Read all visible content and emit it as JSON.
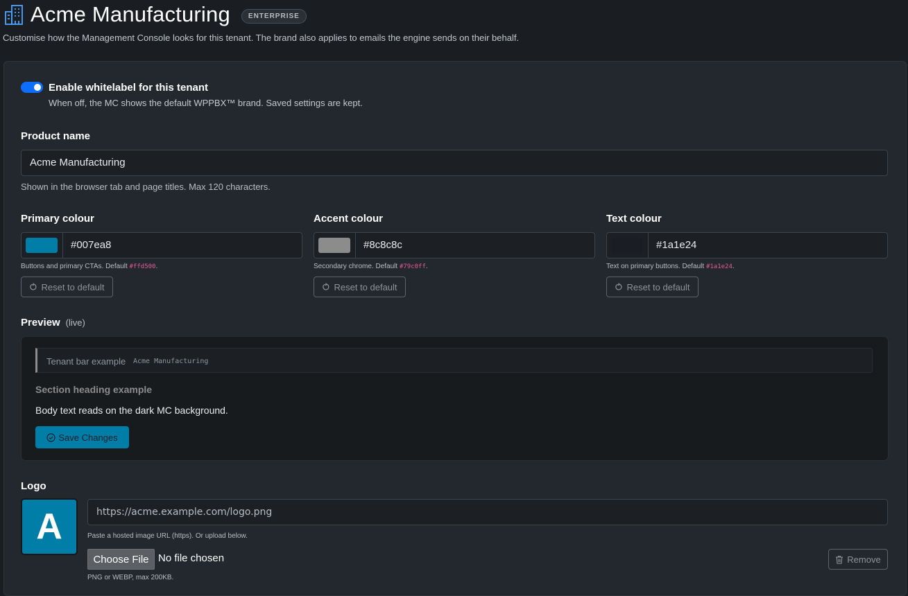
{
  "header": {
    "title": "Acme Manufacturing",
    "badge": "ENTERPRISE",
    "subtitle": "Customise how the Management Console looks for this tenant. The brand also applies to emails the engine sends on their behalf.",
    "icon": "building-icon"
  },
  "whitelabel": {
    "enabled": true,
    "label": "Enable whitelabel for this tenant",
    "help": "When off, the MC shows the default WPPBX™ brand. Saved settings are kept."
  },
  "product_name": {
    "label": "Product name",
    "value": "Acme Manufacturing",
    "help": "Shown in the browser tab and page titles. Max 120 characters."
  },
  "colours": [
    {
      "label": "Primary colour",
      "value": "#007ea8",
      "swatch": "#007ea8",
      "help": "Buttons and primary CTAs. Default ",
      "default": "#ffd500",
      "help_end": ".",
      "reset_label": "Reset to default"
    },
    {
      "label": "Accent colour",
      "value": "#8c8c8c",
      "swatch": "#8c8c8c",
      "help": "Secondary chrome. Default ",
      "default": "#79c0ff",
      "help_end": ".",
      "reset_label": "Reset to default"
    },
    {
      "label": "Text colour",
      "value": "#1a1e24",
      "swatch": "#1a1e24",
      "help": "Text on primary buttons. Default ",
      "default": "#1a1e24",
      "help_end": ".",
      "reset_label": "Reset to default"
    }
  ],
  "preview": {
    "label": "Preview",
    "live": "(live)",
    "tenant_bar_label": "Tenant bar example",
    "tenant_bar_value": "Acme Manufacturing",
    "section_heading": "Section heading example",
    "body_text": "Body text reads on the dark MC background.",
    "button_label": "Save Changes"
  },
  "logo": {
    "label": "Logo",
    "letter": "A",
    "url_value": "https://acme.example.com/logo.png",
    "url_help": "Paste a hosted image URL (https). Or upload below.",
    "choose_label": "Choose File",
    "no_file": "No file chosen",
    "remove_label": "Remove",
    "formats_help": "PNG or WEBP, max 200KB."
  }
}
